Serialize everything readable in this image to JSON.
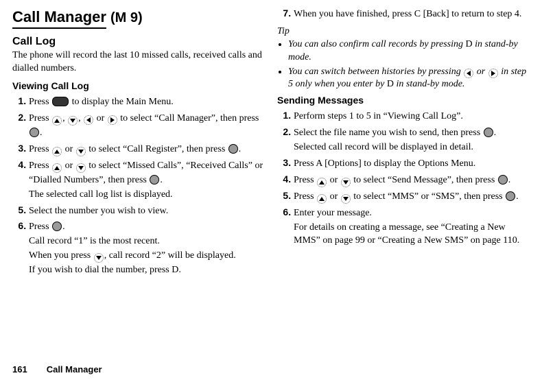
{
  "page": {
    "title_underline": "Call Manager",
    "title_suffix": "(M 9)"
  },
  "col1": {
    "h2": "Call Log",
    "intro": "The phone will record the last 10 missed calls, received calls and dialled numbers.",
    "h3": "Viewing Call Log",
    "steps": {
      "s1a": "Press ",
      "s1b": " to display the Main Menu.",
      "s2a": "Press ",
      "s2b": ", ",
      "s2c": ", ",
      "s2d": " or ",
      "s2e": " to select “Call Manager”, then press ",
      "s2f": ".",
      "s3a": "Press ",
      "s3b": " or ",
      "s3c": " to select “Call Register”, then press ",
      "s3d": ".",
      "s4a": "Press ",
      "s4b": " or ",
      "s4c": " to select “Missed Calls”, “Received Calls” or “Dialled Numbers”, then press ",
      "s4d": ".",
      "s4extra": "The selected call log list is displayed.",
      "s5": "Select the number you wish to view.",
      "s6a": "Press ",
      "s6b": ".",
      "s6extra1": "Call record “1” is the most recent.",
      "s6extra2a": "When you press ",
      "s6extra2b": ", call record “2” will be displayed.",
      "s6extra3a": "If you wish to dial the number, press ",
      "s6extra3b": "D",
      "s6extra3c": "."
    }
  },
  "col2": {
    "steps_top": {
      "s7a": "When you have finished, press ",
      "s7b": "C",
      "s7c": " [Back] to return to step 4."
    },
    "tip_label": "Tip",
    "tips": {
      "t1a": "You can also confirm call records by pressing ",
      "t1b": "D",
      "t1c": " in stand-by mode.",
      "t2a": "You can switch between histories by pressing ",
      "t2b": " or ",
      "t2c": " in step 5 only when you enter by ",
      "t2d": "D",
      "t2e": " in stand-by mode."
    },
    "h3": "Sending Messages",
    "steps": {
      "s1": "Perform steps 1 to 5 in “Viewing Call Log”.",
      "s2a": "Select the file name you wish to send, then press ",
      "s2b": ". Selected call record will be displayed in detail.",
      "s3a": "Press ",
      "s3b": "A",
      "s3c": " [Options] to display the Options Menu.",
      "s4a": "Press ",
      "s4b": " or ",
      "s4c": " to select “Send Message”, then press ",
      "s4d": ".",
      "s5a": "Press ",
      "s5b": " or ",
      "s5c": " to select “MMS” or “SMS”, then press ",
      "s5d": ".",
      "s6": "Enter your message.",
      "s6extra": "For details on creating a message, see “Creating a New MMS” on page 99 or “Creating a New SMS” on page 110."
    }
  },
  "footer": {
    "pagenum": "161",
    "section": "Call Manager"
  }
}
